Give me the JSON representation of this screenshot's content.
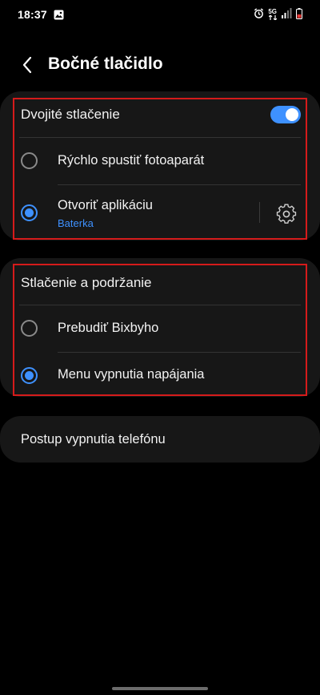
{
  "status_bar": {
    "time": "18:37",
    "network": "5G"
  },
  "header": {
    "title": "Bočné tlačidlo"
  },
  "double_press": {
    "title": "Dvojité stlačenie",
    "toggle_on": true,
    "options": [
      {
        "label": "Rýchlo spustiť fotoaparát",
        "selected": false
      },
      {
        "label": "Otvoriť aplikáciu",
        "sub": "Baterka",
        "selected": true
      }
    ]
  },
  "press_hold": {
    "title": "Stlačenie a podržanie",
    "options": [
      {
        "label": "Prebudiť Bixbyho",
        "selected": false
      },
      {
        "label": "Menu vypnutia napájania",
        "selected": true
      }
    ]
  },
  "shutdown": {
    "label": "Postup vypnutia telefónu"
  },
  "colors": {
    "accent": "#3e91ff",
    "highlight_outline": "#d51b1b",
    "card_bg": "#171717"
  }
}
